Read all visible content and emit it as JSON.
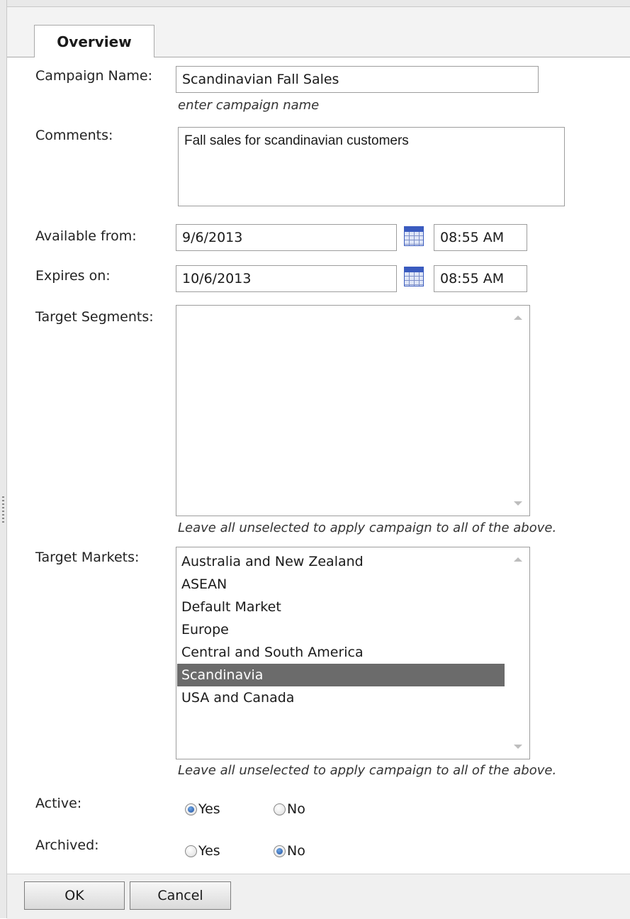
{
  "tabs": [
    {
      "label": "Overview",
      "active": true
    }
  ],
  "form": {
    "campaign_name": {
      "label": "Campaign Name:",
      "value": "Scandinavian Fall Sales",
      "hint": "enter campaign name"
    },
    "comments": {
      "label": "Comments:",
      "value": "Fall sales for scandinavian customers"
    },
    "available_from": {
      "label": "Available from:",
      "date": "9/6/2013",
      "time": "08:55 AM",
      "calendar_icon": "calendar-icon"
    },
    "expires_on": {
      "label": "Expires on:",
      "date": "10/6/2013",
      "time": "08:55 AM",
      "calendar_icon": "calendar-icon"
    },
    "target_segments": {
      "label": "Target Segments:",
      "items": [],
      "hint": "Leave all unselected to apply campaign to all of the above."
    },
    "target_markets": {
      "label": "Target Markets:",
      "items": [
        "Australia and New Zealand",
        "ASEAN",
        "Default Market",
        "Europe",
        "Central and South America",
        "Scandinavia",
        "USA and Canada"
      ],
      "selected": "Scandinavia",
      "hint": "Leave all unselected to apply campaign to all of the above."
    },
    "active": {
      "label": "Active:",
      "options": [
        "Yes",
        "No"
      ],
      "selected": "Yes"
    },
    "archived": {
      "label": "Archived:",
      "options": [
        "Yes",
        "No"
      ],
      "selected": "No"
    }
  },
  "buttons": {
    "ok": "OK",
    "cancel": "Cancel"
  },
  "colors": {
    "selected_row": "#6b6b6b",
    "radio_on": "#1f4f9e"
  }
}
